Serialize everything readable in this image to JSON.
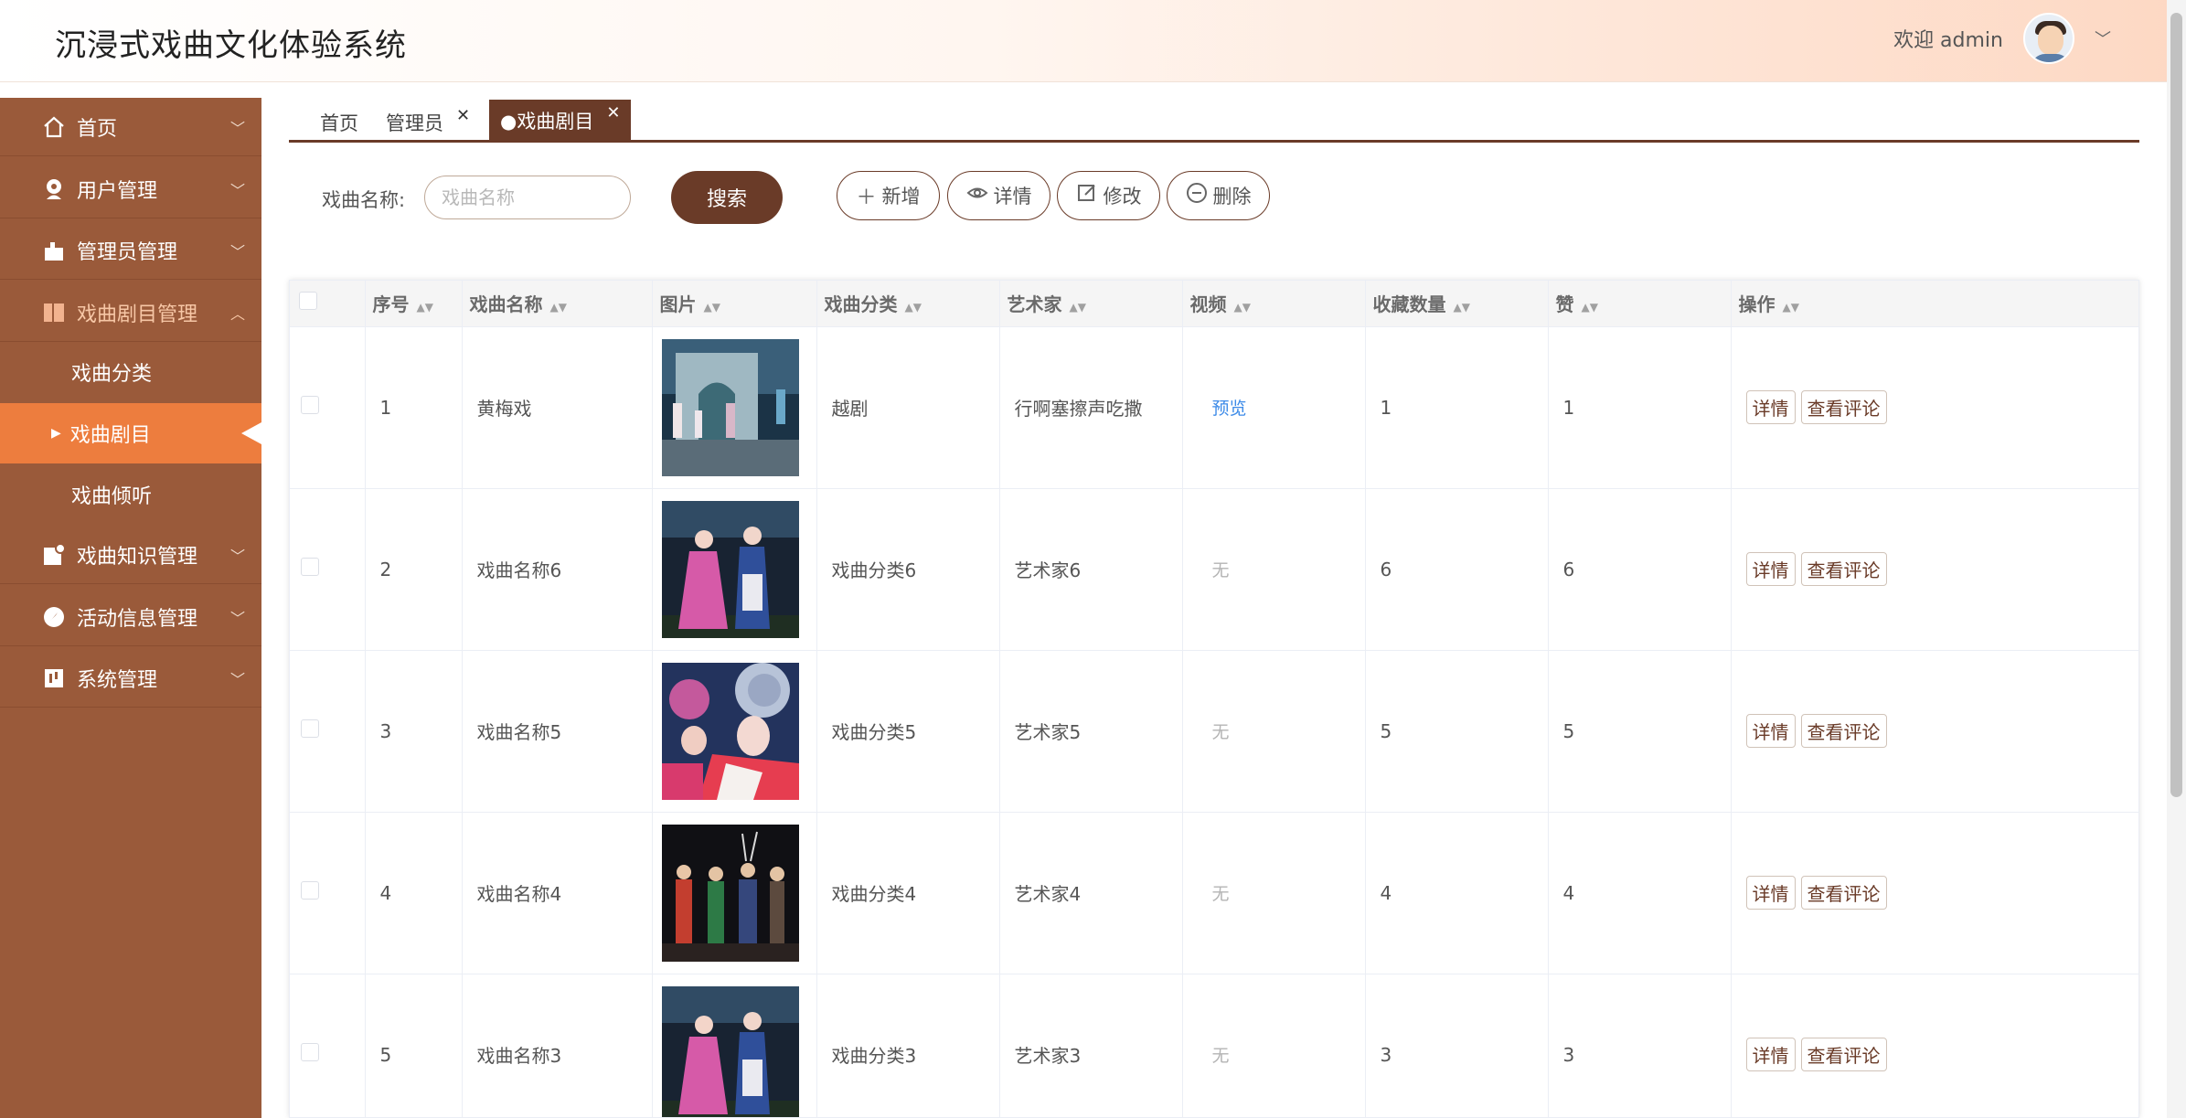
{
  "app": {
    "title": "沉浸式戏曲文化体验系统",
    "welcome": "欢迎 admin"
  },
  "sidebar": {
    "items": [
      {
        "label": "首页",
        "icon": "home-icon",
        "expanded": false
      },
      {
        "label": "用户管理",
        "icon": "user-icon",
        "expanded": false
      },
      {
        "label": "管理员管理",
        "icon": "admin-icon",
        "expanded": false
      },
      {
        "label": "戏曲剧目管理",
        "icon": "book-icon",
        "expanded": true
      },
      {
        "label": "戏曲知识管理",
        "icon": "knowledge-icon",
        "expanded": false
      },
      {
        "label": "活动信息管理",
        "icon": "compass-icon",
        "expanded": false
      },
      {
        "label": "系统管理",
        "icon": "settings-icon",
        "expanded": false
      }
    ],
    "sub_items": [
      {
        "label": "戏曲分类",
        "active": false
      },
      {
        "label": "戏曲剧目",
        "active": true
      },
      {
        "label": "戏曲倾听",
        "active": false
      }
    ]
  },
  "tabs": [
    {
      "label": "首页",
      "closable": false,
      "active": false
    },
    {
      "label": "管理员",
      "closable": true,
      "active": false
    },
    {
      "label": "●戏曲剧目",
      "closable": true,
      "active": true
    }
  ],
  "toolbar": {
    "search_label": "戏曲名称:",
    "search_placeholder": "戏曲名称",
    "search_button": "搜索",
    "add_button": "新增",
    "detail_button": "详情",
    "edit_button": "修改",
    "delete_button": "删除"
  },
  "table": {
    "columns": [
      "序号",
      "戏曲名称",
      "图片",
      "戏曲分类",
      "艺术家",
      "视频",
      "收藏数量",
      "赞",
      "操作"
    ],
    "rows": [
      {
        "seq": "1",
        "name": "黄梅戏",
        "category": "越剧",
        "artist": "行啊塞擦声吃撒",
        "video": "预览",
        "has_video": true,
        "favorites": "1",
        "likes": "1",
        "image": "stage-scene"
      },
      {
        "seq": "2",
        "name": "戏曲名称6",
        "category": "戏曲分类6",
        "artist": "艺术家6",
        "video": "无",
        "has_video": false,
        "favorites": "6",
        "likes": "6",
        "image": "duet-performers"
      },
      {
        "seq": "3",
        "name": "戏曲名称5",
        "category": "戏曲分类5",
        "artist": "艺术家5",
        "video": "无",
        "has_video": false,
        "favorites": "5",
        "likes": "5",
        "image": "headdress-closeup"
      },
      {
        "seq": "4",
        "name": "戏曲名称4",
        "category": "戏曲分类4",
        "artist": "艺术家4",
        "video": "无",
        "has_video": false,
        "favorites": "4",
        "likes": "4",
        "image": "group-performers"
      },
      {
        "seq": "5",
        "name": "戏曲名称3",
        "category": "戏曲分类3",
        "artist": "艺术家3",
        "video": "无",
        "has_video": false,
        "favorites": "3",
        "likes": "3",
        "image": "duet-performers"
      }
    ],
    "row_actions": {
      "detail": "详情",
      "comments": "查看评论"
    }
  },
  "colors": {
    "sidebar": "#9a5a3a",
    "active_menu": "#ed7d3e",
    "accent": "#6a3b28",
    "link": "#3d8be8"
  }
}
